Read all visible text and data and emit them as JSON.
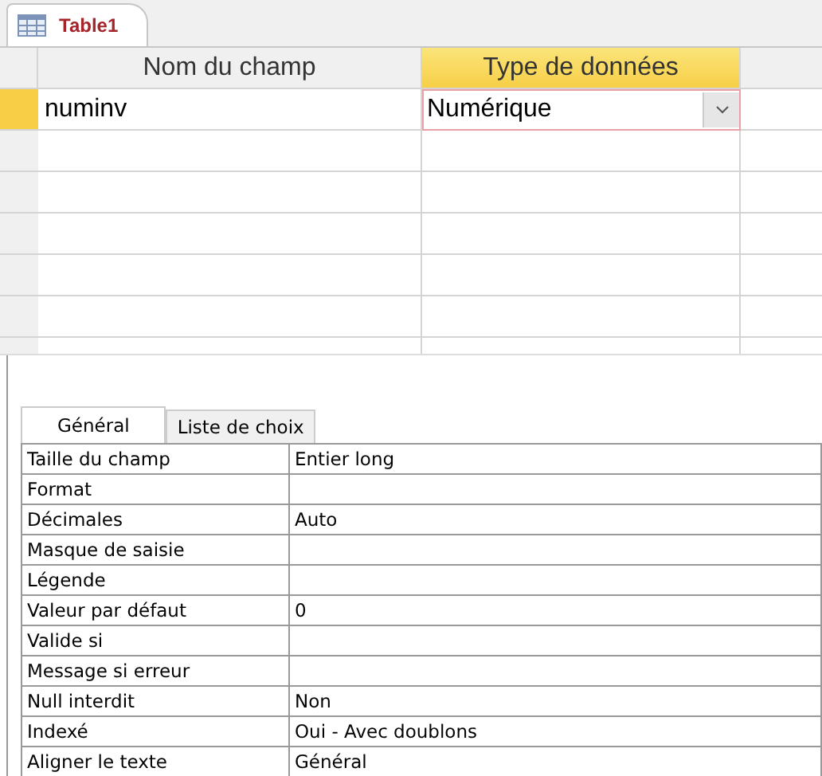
{
  "document_tab": {
    "title": "Table1"
  },
  "design_grid": {
    "columns": [
      "Nom du champ",
      "Type de données"
    ],
    "rows": [
      {
        "field_name": "numinv",
        "data_type": "Numérique",
        "selected": true
      }
    ]
  },
  "properties": {
    "tabs": [
      {
        "label": "Général",
        "selected": true
      },
      {
        "label": "Liste de choix",
        "selected": false
      }
    ],
    "rows": [
      {
        "label": "Taille du champ",
        "value": "Entier long"
      },
      {
        "label": "Format"
      },
      {
        "label": "Décimales",
        "value": "Auto"
      },
      {
        "label": "Masque de saisie"
      },
      {
        "label": "Légende"
      },
      {
        "label": "Valeur par défaut",
        "value": "0"
      },
      {
        "label": "Valide si"
      },
      {
        "label": "Message si erreur"
      },
      {
        "label": "Null interdit",
        "value": "Non"
      },
      {
        "label": "Indexé",
        "value": "Oui - Avec doublons"
      },
      {
        "label": "Aligner le texte",
        "value": "Général"
      }
    ]
  }
}
